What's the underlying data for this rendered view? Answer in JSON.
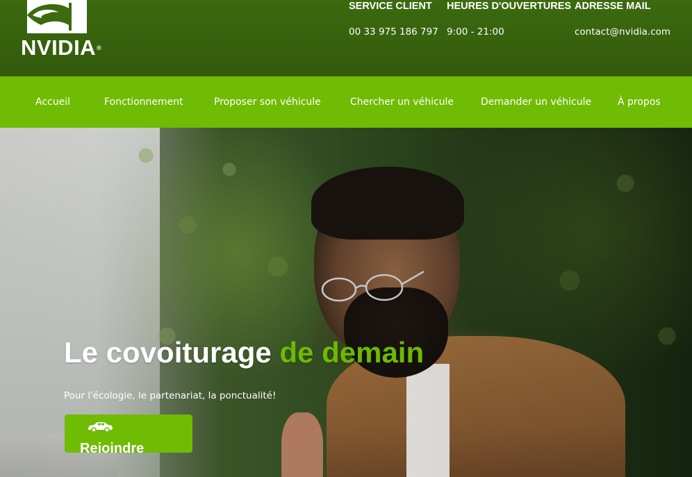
{
  "brand": {
    "name": "NVIDIA",
    "registered_mark": "®",
    "logo_icon": "nvidia-eye-logo-icon"
  },
  "header": {
    "columns": [
      {
        "heading": "SERVICE CLIENT",
        "value": "00 33 975 186 797"
      },
      {
        "heading": "HEURES D'OUVERTURES",
        "value": "9:00 - 21:00"
      },
      {
        "heading": "ADRESSE MAIL",
        "value": "contact@nvidia.com"
      }
    ]
  },
  "nav": {
    "items": [
      {
        "label": "Accueil"
      },
      {
        "label": "Fonctionnement"
      },
      {
        "label": "Proposer son véhicule"
      },
      {
        "label": "Chercher un véhicule"
      },
      {
        "label": "Demander un véhicule"
      },
      {
        "label": "À propos"
      }
    ]
  },
  "hero": {
    "title_main": "Le covoiturage ",
    "title_accent": "de demain",
    "subtitle": "Pour l'écologie, le partenariat, la ponctualité!",
    "cta": {
      "icon": "car-icon",
      "label": "Rejoindre"
    }
  },
  "colors": {
    "header_bg": "#3b6a0f",
    "nav_bg": "#70bb03",
    "accent_text": "#6dbb00",
    "white": "#ffffff"
  }
}
